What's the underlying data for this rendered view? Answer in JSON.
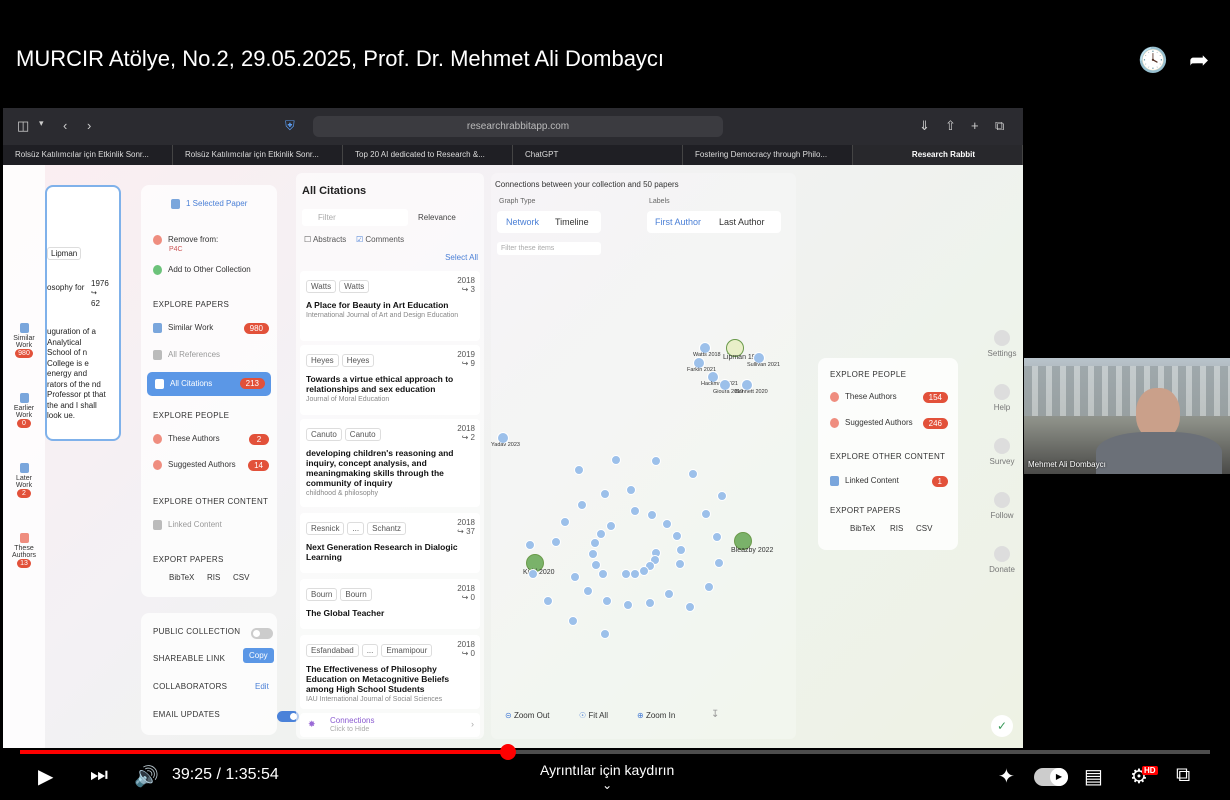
{
  "video": {
    "title": "MURCIR Atölye, No.2, 29.05.2025, Prof. Dr. Mehmet Ali Dombaycı",
    "time_current": "39:25",
    "time_total": "1:35:54",
    "time_separator": " / ",
    "scroll_hint": "Ayrıntılar için kaydırın",
    "progress": 0.41,
    "presenter_name": "Mehmet Ali Dombaycı",
    "quality_badge": "HD"
  },
  "browser": {
    "url": "researchrabbitapp.com",
    "tabs": [
      "Rolsüz Katılımcılar için Etkinlik Sonr...",
      "Rolsüz Katılımcılar için Etkinlik Sonr...",
      "Top 20 AI dedicated to Research &...",
      "ChatGPT",
      "Fostering Democracy through Philo...",
      "Research Rabbit"
    ]
  },
  "left_strip": [
    {
      "label": "Similar Work",
      "count": "980"
    },
    {
      "label": "Earlier Work",
      "count": "0"
    },
    {
      "label": "Later Work",
      "count": "2"
    },
    {
      "label": "These Authors",
      "count": "13"
    }
  ],
  "paper_panel": {
    "author": "Lipman",
    "source": "osophy for",
    "year": "1976",
    "cited": "62",
    "abstract": "uguration of a Analytical School of n College is e energy and rators of the nd Professor pt that the and I shall look ue."
  },
  "collection": {
    "selected": "1 Selected Paper",
    "remove_from": "Remove from:",
    "collection_name": "P4C",
    "add_to_other": "Add to Other Collection",
    "explore_papers": "EXPLORE PAPERS",
    "similar_work": "Similar Work",
    "similar_count": "980",
    "all_references": "All References",
    "all_citations": "All Citations",
    "citations_count": "213",
    "explore_people": "EXPLORE PEOPLE",
    "these_authors": "These Authors",
    "these_authors_count": "2",
    "suggested_authors": "Suggested Authors",
    "suggested_count": "14",
    "explore_other": "EXPLORE OTHER CONTENT",
    "linked_content": "Linked Content",
    "export_papers": "EXPORT PAPERS",
    "export_bibtex": "BibTeX",
    "export_ris": "RIS",
    "export_csv": "CSV",
    "public_collection": "PUBLIC COLLECTION",
    "shareable_link": "SHAREABLE LINK",
    "copy": "Copy",
    "collaborators": "COLLABORATORS",
    "edit": "Edit",
    "email_updates": "EMAIL UPDATES"
  },
  "citations": {
    "heading": "All Citations",
    "filter_placeholder": "Filter",
    "sort": "Relevance",
    "abstracts": "Abstracts",
    "comments": "Comments",
    "select_all": "Select All",
    "items": [
      {
        "a1": "Watts",
        "a2": "Watts",
        "year": "2018",
        "cites": "↪ 3",
        "title": "A Place for Beauty in Art Education",
        "journal": "International Journal of Art and Design Education"
      },
      {
        "a1": "Heyes",
        "a2": "Heyes",
        "year": "2019",
        "cites": "↪ 9",
        "title": "Towards a virtue ethical approach to relationships and sex education",
        "journal": "Journal of Moral Education"
      },
      {
        "a1": "Canuto",
        "a2": "Canuto",
        "year": "2018",
        "cites": "↪ 2",
        "title": "developing children's reasoning and inquiry, concept analysis, and meaningmaking skills through the community of inquiry",
        "journal": "childhood & philosophy"
      },
      {
        "a1": "Resnick",
        "a2": "Schantz",
        "year": "2018",
        "cites": "↪ 37",
        "title": "Next Generation Research in Dialogic Learning",
        "journal": ""
      },
      {
        "a1": "Bourn",
        "a2": "Bourn",
        "year": "2018",
        "cites": "↪ 0",
        "title": "The Global Teacher",
        "journal": ""
      },
      {
        "a1": "Esfandabad",
        "a2": "Emamipour",
        "year": "2018",
        "cites": "↪ 0",
        "title": "The Effectiveness of Philosophy Education on Metacognitive Beliefs among High School Students",
        "journal": "IAU International Journal of Social Sciences"
      }
    ],
    "ellipsis": "...",
    "connections": "Connections",
    "click_hide": "Click to Hide"
  },
  "graph": {
    "heading": "Connections between your collection and 50 papers",
    "graph_type": "Graph Type",
    "network": "Network",
    "timeline": "Timeline",
    "labels": "Labels",
    "first_author": "First Author",
    "last_author": "Last Author",
    "filter_placeholder": "Filter these items",
    "zoom_out": "Zoom Out",
    "fit_all": "Fit All",
    "zoom_in": "Zoom In",
    "nodes": [
      {
        "t": "Lipman",
        "y": "1982"
      },
      {
        "t": "Watts",
        "y": "2018"
      },
      {
        "t": "Sullivan",
        "y": "2021"
      },
      {
        "t": "Farkin",
        "y": "2021"
      },
      {
        "t": "Hackman",
        "y": "2021"
      },
      {
        "t": "Gioura",
        "y": "2019"
      },
      {
        "t": "Bennett",
        "y": "2020"
      },
      {
        "t": "Yadav",
        "y": "2023"
      },
      {
        "t": "Kidd",
        "y": "2020"
      },
      {
        "t": "Bleazby",
        "y": "2022"
      }
    ]
  },
  "right_panel": {
    "explore_people": "EXPLORE PEOPLE",
    "these_authors": "These Authors",
    "these_count": "154",
    "suggested_authors": "Suggested Authors",
    "suggested_count": "246",
    "explore_other": "EXPLORE OTHER CONTENT",
    "linked_content": "Linked Content",
    "linked_count": "1",
    "export_papers": "EXPORT PAPERS",
    "bibtex": "BibTeX",
    "ris": "RIS",
    "csv": "CSV"
  },
  "side_menu": [
    "Settings",
    "Help",
    "Survey",
    "Follow",
    "Donate"
  ]
}
